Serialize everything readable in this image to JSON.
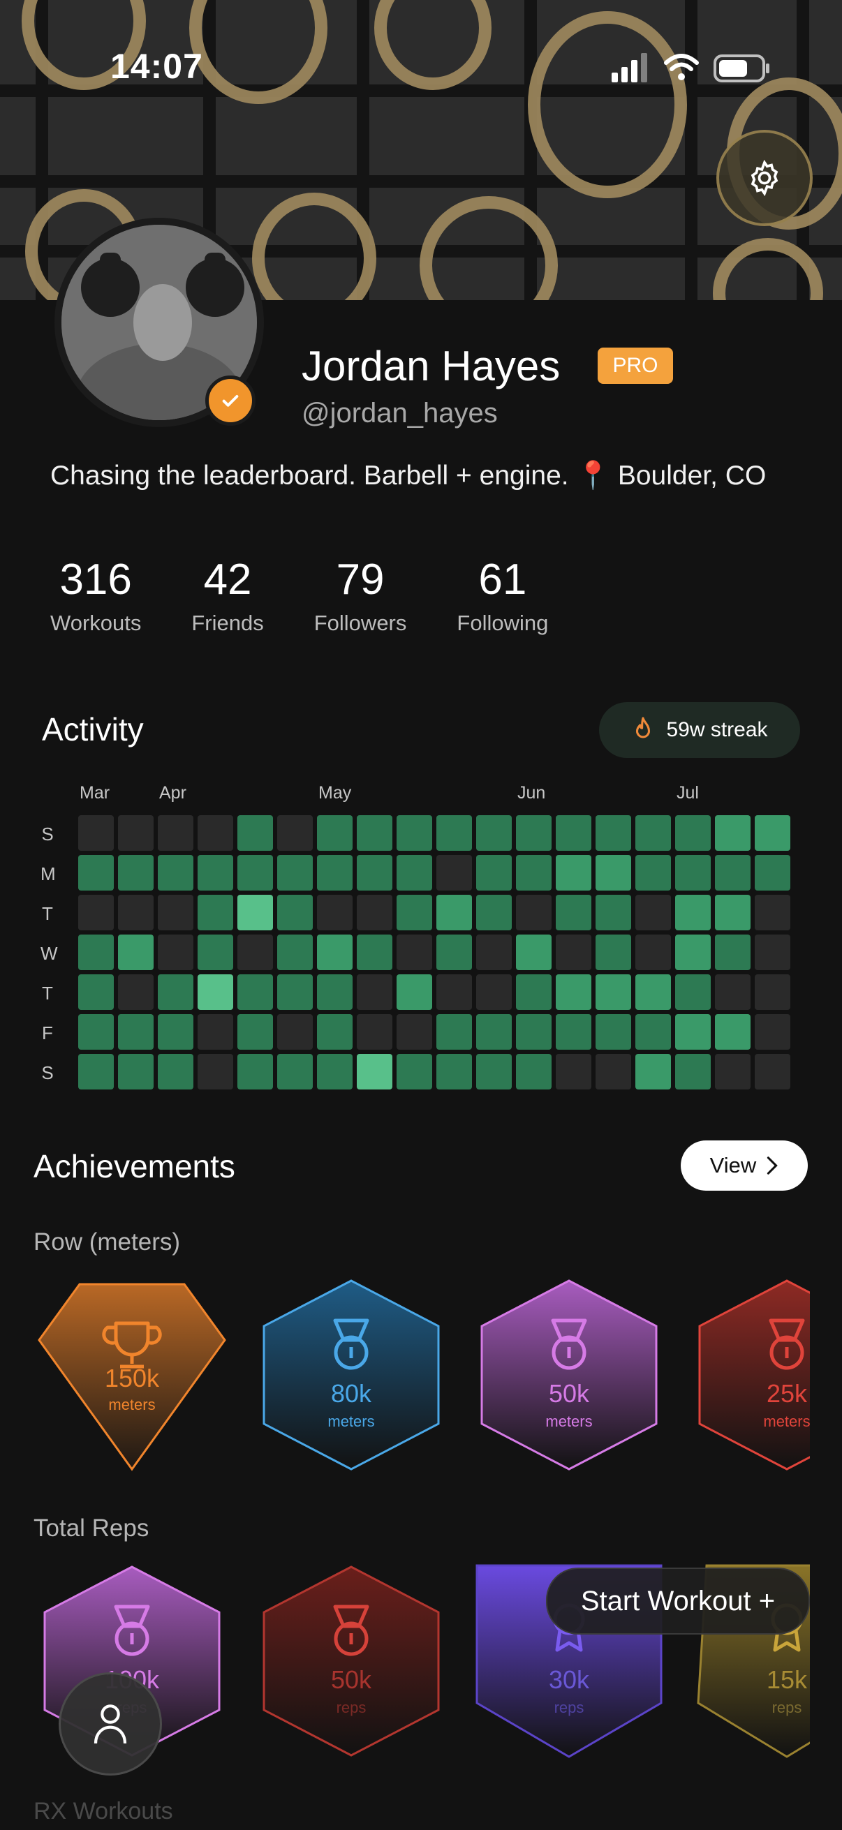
{
  "status_bar": {
    "time": "14:07"
  },
  "profile": {
    "name": "Jordan Hayes",
    "badge": "PRO",
    "handle": "@jordan_hayes",
    "bio": "Chasing the leaderboard. Barbell + engine. 📍 Boulder, CO"
  },
  "stats": [
    {
      "value": "316",
      "label": "Workouts"
    },
    {
      "value": "42",
      "label": "Friends"
    },
    {
      "value": "79",
      "label": "Followers"
    },
    {
      "value": "61",
      "label": "Following"
    }
  ],
  "activity": {
    "title": "Activity",
    "streak": "59w streak",
    "months": [
      "Mar",
      "Apr",
      "May",
      "Jun",
      "Jul"
    ],
    "days": [
      "S",
      "M",
      "T",
      "W",
      "T",
      "F",
      "S"
    ],
    "heatmap": [
      [
        0,
        0,
        0,
        0,
        1,
        0,
        1,
        1,
        1,
        1,
        1,
        1,
        1,
        1,
        1,
        1,
        2,
        2
      ],
      [
        1,
        1,
        1,
        1,
        1,
        1,
        1,
        1,
        1,
        0,
        1,
        1,
        2,
        2,
        1,
        1,
        1,
        1
      ],
      [
        0,
        0,
        0,
        1,
        3,
        1,
        0,
        0,
        1,
        2,
        1,
        0,
        1,
        1,
        0,
        2,
        2,
        0
      ],
      [
        1,
        2,
        0,
        1,
        0,
        1,
        2,
        1,
        0,
        1,
        0,
        2,
        0,
        1,
        0,
        2,
        1,
        0
      ],
      [
        1,
        0,
        1,
        3,
        1,
        1,
        1,
        0,
        2,
        0,
        0,
        1,
        2,
        2,
        2,
        1,
        0,
        0
      ],
      [
        1,
        1,
        1,
        0,
        1,
        0,
        1,
        0,
        0,
        1,
        1,
        1,
        1,
        1,
        1,
        2,
        2,
        0
      ],
      [
        1,
        1,
        1,
        0,
        1,
        1,
        1,
        3,
        1,
        1,
        1,
        1,
        0,
        0,
        2,
        1,
        0,
        0
      ]
    ],
    "colors": [
      "#2a2a2a",
      "#2d7a53",
      "#3a9a69",
      "#58c08a"
    ]
  },
  "achievements": {
    "title": "Achievements",
    "view_label": "View",
    "row_title": "Row (meters)",
    "row_badges": [
      {
        "value": "150k",
        "unit": "meters",
        "color": "#f1852c",
        "icon": "trophy-icon"
      },
      {
        "value": "80k",
        "unit": "meters",
        "color": "#4aa8e8",
        "icon": "medal-icon"
      },
      {
        "value": "50k",
        "unit": "meters",
        "color": "#d67be6",
        "icon": "medal-icon"
      },
      {
        "value": "25k",
        "unit": "meters",
        "color": "#e0443b",
        "icon": "medal-icon"
      }
    ],
    "reps_title": "Total Reps",
    "reps_badges": [
      {
        "value": "100k",
        "unit": "reps",
        "color": "#d67be6",
        "icon": "medal-icon"
      },
      {
        "value": "50k",
        "unit": "reps",
        "color": "#d6423a",
        "icon": "medal-icon"
      },
      {
        "value": "30k",
        "unit": "reps",
        "color": "#7a5cf0",
        "icon": "ribbon-icon"
      },
      {
        "value": "15k",
        "unit": "reps",
        "color": "#c9a53a",
        "icon": "ribbon-icon"
      }
    ],
    "rx_title": "RX Workouts"
  },
  "start_workout_label": "Start Workout +"
}
